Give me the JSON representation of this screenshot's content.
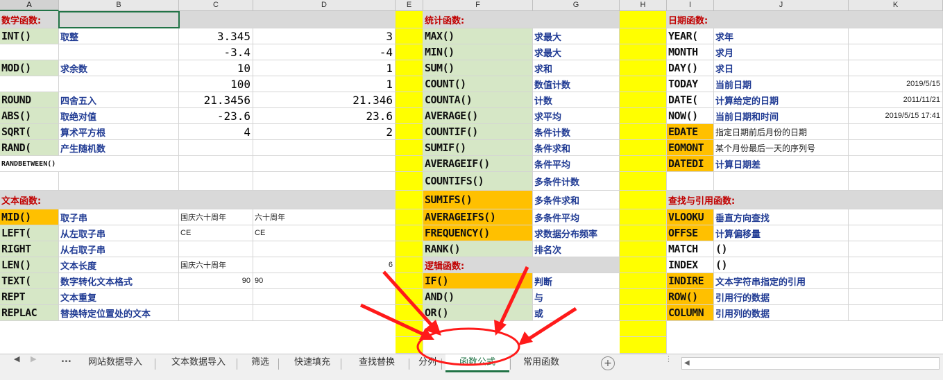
{
  "columns": [
    "A",
    "B",
    "C",
    "D",
    "E",
    "F",
    "G",
    "H",
    "I",
    "J",
    "K"
  ],
  "math": {
    "title": "数学函数",
    "rows": [
      {
        "fn": "INT()",
        "desc": "取整",
        "c": "3.345",
        "d": "3"
      },
      {
        "fn": "",
        "desc": "",
        "c": "-3.4",
        "d": "-4"
      },
      {
        "fn": "MOD()",
        "desc": "求余数",
        "c": "10",
        "d": "1"
      },
      {
        "fn": "",
        "desc": "",
        "c": "100",
        "d": "1"
      },
      {
        "fn": "ROUND",
        "desc": "四舍五入",
        "c": "21.3456",
        "d": "21.346"
      },
      {
        "fn": "ABS()",
        "desc": "取绝对值",
        "c": "-23.6",
        "d": "23.6"
      },
      {
        "fn": "SQRT(",
        "desc": "算术平方根",
        "c": "4",
        "d": "2"
      },
      {
        "fn": "RAND(",
        "desc": "产生随机数",
        "c": "",
        "d": ""
      },
      {
        "fn": "RANDBETWEEN()",
        "desc": "",
        "c": "",
        "d": ""
      }
    ]
  },
  "text": {
    "title": "文本函数",
    "rows": [
      {
        "fn": "MID()",
        "desc": "取子串",
        "c": "国庆六十周年",
        "d": "六十周年"
      },
      {
        "fn": "LEFT(",
        "desc": "从左取子串",
        "c": "CE",
        "d": "CE"
      },
      {
        "fn": "RIGHT",
        "desc": "从右取子串",
        "c": "",
        "d": ""
      },
      {
        "fn": "LEN()",
        "desc": "文本长度",
        "c": "国庆六十周年",
        "d": "6"
      },
      {
        "fn": "TEXT(",
        "desc": "数字转化文本格式",
        "c": "90",
        "d": "90"
      },
      {
        "fn": "REPT",
        "desc": "文本重复",
        "c": "",
        "d": ""
      },
      {
        "fn": "REPLAC",
        "desc": "替换特定位置处的文本",
        "c": "",
        "d": ""
      }
    ]
  },
  "stats": {
    "title": "统计函数",
    "rows": [
      {
        "fn": "MAX()",
        "desc": "求最大"
      },
      {
        "fn": "MIN()",
        "desc": "求最大"
      },
      {
        "fn": "SUM()",
        "desc": "求和"
      },
      {
        "fn": "COUNT()",
        "desc": "数值计数"
      },
      {
        "fn": "COUNTA()",
        "desc": "计数"
      },
      {
        "fn": "AVERAGE()",
        "desc": "求平均"
      },
      {
        "fn": "COUNTIF()",
        "desc": "条件计数"
      },
      {
        "fn": "SUMIF()",
        "desc": "条件求和"
      },
      {
        "fn": "AVERAGEIF()",
        "desc": "条件平均"
      },
      {
        "fn": "COUNTIFS()",
        "desc": "多条件计数"
      },
      {
        "fn": "SUMIFS()",
        "desc": "多条件求和"
      },
      {
        "fn": "AVERAGEIFS()",
        "desc": "多条件平均"
      },
      {
        "fn": "FREQUENCY()",
        "desc": "求数据分布频率"
      },
      {
        "fn": "RANK()",
        "desc": "排名次"
      }
    ]
  },
  "logic": {
    "title": "逻辑函数",
    "rows": [
      {
        "fn": "IF()",
        "desc": "判断"
      },
      {
        "fn": "AND()",
        "desc": "与"
      },
      {
        "fn": "OR()",
        "desc": "或"
      }
    ]
  },
  "date": {
    "title": "日期函数",
    "rows": [
      {
        "fn": "YEAR(",
        "desc": "求年",
        "k": ""
      },
      {
        "fn": "MONTH",
        "desc": "求月",
        "k": ""
      },
      {
        "fn": "DAY()",
        "desc": "求日",
        "k": ""
      },
      {
        "fn": "TODAY",
        "desc": "当前日期",
        "k": "2019/5/15"
      },
      {
        "fn": "DATE(",
        "desc": "计算给定的日期",
        "k": "2011/11/21"
      },
      {
        "fn": "NOW()",
        "desc": "当前日期和时间",
        "k": "2019/5/15 17:41"
      },
      {
        "fn": "EDATE",
        "desc": "指定日期前后月份的日期",
        "k": ""
      },
      {
        "fn": "EOMONT",
        "desc": "某个月份最后一天的序列号",
        "k": ""
      },
      {
        "fn": "DATEDI",
        "desc": "计算日期差",
        "k": ""
      }
    ]
  },
  "lookup": {
    "title": "查找与引用函数",
    "rows": [
      {
        "fn": "VLOOKU",
        "desc": "垂直方向查找"
      },
      {
        "fn": "OFFSE",
        "desc": "计算偏移量"
      },
      {
        "fn": "MATCH",
        "desc": "()"
      },
      {
        "fn": "INDEX",
        "desc": "()"
      },
      {
        "fn": "INDIRE",
        "desc": "文本字符串指定的引用"
      },
      {
        "fn": "ROW()",
        "desc": "引用行的数据"
      },
      {
        "fn": "COLUMN",
        "desc": "引用列的数据"
      }
    ]
  },
  "tabs": {
    "ellipsis": "...",
    "items": [
      "网站数据导入",
      "文本数据导入",
      "筛选",
      "快速填充",
      "查找替换",
      "分列",
      "函数公式",
      "常用函数"
    ],
    "active_index": 6,
    "add": "+"
  },
  "colors": {
    "green": "#d6e7c6",
    "orange": "#ffc000",
    "yellow": "#ffff00",
    "red_annotation": "#ff1a1a",
    "active_tab": "#217346"
  }
}
